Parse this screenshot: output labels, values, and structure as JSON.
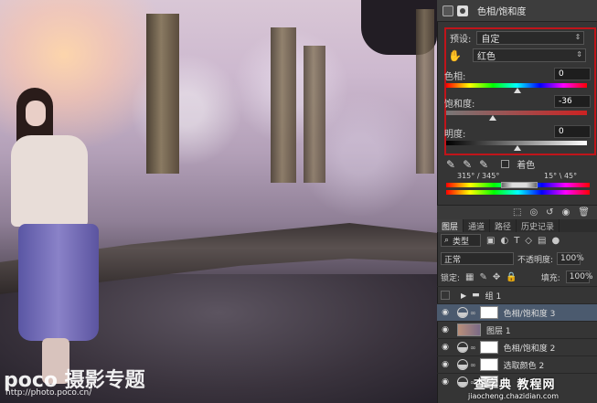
{
  "properties_panel": {
    "title": "色相/饱和度",
    "preset_label": "预设:",
    "preset_value": "自定",
    "channel_value": "红色",
    "hue": {
      "label": "色相:",
      "value": "0"
    },
    "saturation": {
      "label": "饱和度:",
      "value": "-36"
    },
    "lightness": {
      "label": "明度:",
      "value": "0"
    },
    "colorize_label": "着色",
    "range_left": "315° / 345°",
    "range_right": "15° \\ 45°"
  },
  "layers_panel": {
    "tabs": [
      "图层",
      "通道",
      "路径",
      "历史记录"
    ],
    "filter_kind": "类型",
    "blend_mode": "正常",
    "opacity_label": "不透明度:",
    "opacity_value": "100%",
    "lock_label": "锁定:",
    "fill_label": "填充:",
    "fill_value": "100%",
    "layers": [
      {
        "name": "组 1",
        "type": "group"
      },
      {
        "name": "色相/饱和度 3",
        "type": "adjustment",
        "selected": true
      },
      {
        "name": "图层 1",
        "type": "pixel"
      },
      {
        "name": "色相/饱和度 2",
        "type": "adjustment"
      },
      {
        "name": "选取颜色 2",
        "type": "adjustment"
      },
      {
        "name": "",
        "type": "adjustment"
      }
    ]
  },
  "watermarks": {
    "left_title": "poco 摄影专题",
    "left_url": "http://photo.poco.cn/",
    "right_title": "查字典 教程网",
    "right_url": "jiaocheng.chazidian.com"
  },
  "colors": {
    "highlight_box": "#c0141a",
    "selected_layer": "#4b5a6e"
  }
}
